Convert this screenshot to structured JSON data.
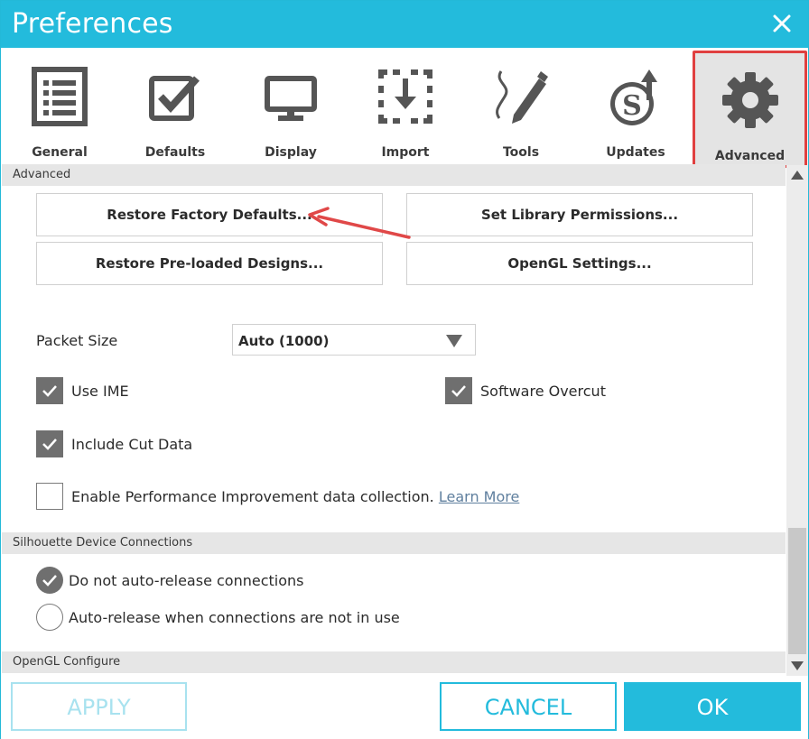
{
  "window": {
    "title": "Preferences",
    "close_icon": "close-icon"
  },
  "toolbar": {
    "items": [
      {
        "label": "General",
        "icon": "general-list-icon"
      },
      {
        "label": "Defaults",
        "icon": "defaults-check-icon"
      },
      {
        "label": "Display",
        "icon": "display-monitor-icon"
      },
      {
        "label": "Import",
        "icon": "import-icon"
      },
      {
        "label": "Tools",
        "icon": "tools-pen-icon"
      },
      {
        "label": "Updates",
        "icon": "updates-icon"
      },
      {
        "label": "Advanced",
        "icon": "gear-icon",
        "active": true
      }
    ]
  },
  "advanced": {
    "section_title": "Advanced",
    "buttons": {
      "restore_factory": "Restore Factory Defaults...",
      "set_library": "Set Library Permissions...",
      "restore_preloaded": "Restore Pre-loaded Designs...",
      "opengl_settings": "OpenGL Settings..."
    },
    "packet_size": {
      "label": "Packet Size",
      "value": "Auto (1000)"
    },
    "checkboxes": {
      "use_ime": {
        "label": "Use IME",
        "checked": true
      },
      "software_overcut": {
        "label": "Software Overcut",
        "checked": true
      },
      "include_cut_data": {
        "label": "Include Cut Data",
        "checked": true
      },
      "enable_performance": {
        "label": "Enable Performance Improvement data collection.",
        "link": "Learn More",
        "checked": false
      }
    }
  },
  "device_connections": {
    "section_title": "Silhouette Device Connections",
    "options": [
      {
        "label": "Do not auto-release connections",
        "selected": true
      },
      {
        "label": "Auto-release when connections are not in use",
        "selected": false
      }
    ]
  },
  "opengl_configure": {
    "section_title": "OpenGL Configure"
  },
  "footer": {
    "apply": "APPLY",
    "cancel": "CANCEL",
    "ok": "OK"
  },
  "colors": {
    "accent": "#23bbdc",
    "highlight_border": "#e04040",
    "annotation_arrow": "#e04848",
    "checkbox_fill": "#6f6f6f",
    "section_bg": "#e6e6e6",
    "link": "#5f7f9e"
  }
}
